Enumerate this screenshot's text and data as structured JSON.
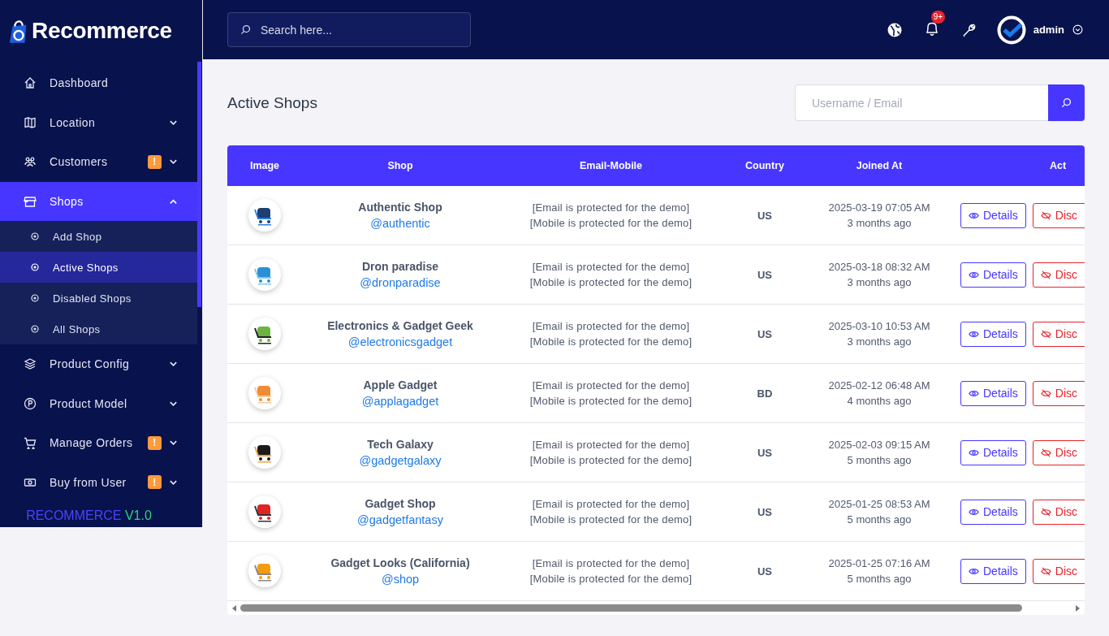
{
  "brand": {
    "name": "Recommerce"
  },
  "search": {
    "placeholder": "Search here..."
  },
  "topbar": {
    "notification_badge": "9+",
    "user": "admin"
  },
  "sidebar": {
    "items": [
      {
        "label": "Dashboard",
        "selected": false
      },
      {
        "label": "Location",
        "selected": false,
        "expanded": false
      },
      {
        "label": "Customers",
        "selected": false,
        "expanded": false,
        "badge": "!"
      },
      {
        "label": "Shops",
        "selected": true,
        "expanded": true,
        "children": [
          {
            "label": "Add Shop",
            "selected": false
          },
          {
            "label": "Active Shops",
            "selected": true
          },
          {
            "label": "Disabled Shops",
            "selected": false
          },
          {
            "label": "All Shops",
            "selected": false
          }
        ]
      },
      {
        "label": "Product Config",
        "selected": false,
        "expanded": false
      },
      {
        "label": "Product Model",
        "selected": false,
        "expanded": false
      },
      {
        "label": "Manage Orders",
        "selected": false,
        "expanded": false,
        "badge": "!"
      },
      {
        "label": "Buy from User",
        "selected": false,
        "expanded": false,
        "badge": "!"
      }
    ],
    "footer": {
      "name": "RECOMMERCE",
      "version": "V1.0"
    }
  },
  "page": {
    "title": "Active Shops",
    "filter": {
      "placeholder": "Username / Email"
    }
  },
  "table": {
    "columns": [
      "Image",
      "Shop",
      "Email-Mobile",
      "Country",
      "Joined At",
      "Act"
    ],
    "rows": [
      {
        "name": "Authentic Shop",
        "handle": "@authentic",
        "email": "[Email is protected for the demo]",
        "mobile": "[Mobile is protected for the demo]",
        "country": "US",
        "date": "2025-03-19 07:05 AM",
        "ago": "3 months ago",
        "actions": [
          "Details",
          "Disc"
        ]
      },
      {
        "name": "Dron paradise",
        "handle": "@dronparadise",
        "email": "[Email is protected for the demo]",
        "mobile": "[Mobile is protected for the demo]",
        "country": "US",
        "date": "2025-03-18 08:32 AM",
        "ago": "3 months ago",
        "actions": [
          "Details",
          "Disc"
        ]
      },
      {
        "name": "Electronics & Gadget Geek",
        "handle": "@electronicsgadget",
        "email": "[Email is protected for the demo]",
        "mobile": "[Mobile is protected for the demo]",
        "country": "US",
        "date": "2025-03-10 10:53 AM",
        "ago": "3 months ago",
        "actions": [
          "Details",
          "Disc"
        ]
      },
      {
        "name": "Apple Gadget",
        "handle": "@applagadget",
        "email": "[Email is protected for the demo]",
        "mobile": "[Mobile is protected for the demo]",
        "country": "BD",
        "date": "2025-02-12 06:48 AM",
        "ago": "4 months ago",
        "actions": [
          "Details",
          "Disc"
        ]
      },
      {
        "name": "Tech Galaxy",
        "handle": "@gadgetgalaxy",
        "email": "[Email is protected for the demo]",
        "mobile": "[Mobile is protected for the demo]",
        "country": "US",
        "date": "2025-02-03 09:15 AM",
        "ago": "5 months ago",
        "actions": [
          "Details",
          "Disc"
        ]
      },
      {
        "name": "Gadget Shop",
        "handle": "@gadgetfantasy",
        "email": "[Email is protected for the demo]",
        "mobile": "[Mobile is protected for the demo]",
        "country": "US",
        "date": "2025-01-25 08:53 AM",
        "ago": "5 months ago",
        "actions": [
          "Details",
          "Disc"
        ]
      },
      {
        "name": "Gadget Looks (California)",
        "handle": "@shop",
        "email": "[Email is protected for the demo]",
        "mobile": "[Mobile is protected for the demo]",
        "country": "US",
        "date": "2025-01-25 07:16 AM",
        "ago": "5 months ago",
        "actions": [
          "Details",
          "Disc"
        ]
      }
    ]
  }
}
